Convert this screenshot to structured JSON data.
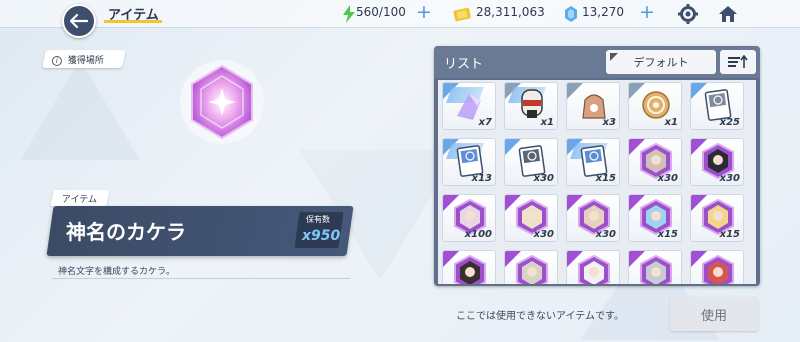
{
  "header": {
    "title": "アイテム",
    "back_icon": "arrow-left-icon",
    "stamina": "560/100",
    "coins": "28,311,063",
    "gems": "13,270",
    "settings_icon": "gear-icon",
    "home_icon": "home-icon"
  },
  "item_detail": {
    "source_button": "獲得場所",
    "category": "アイテム",
    "name": "神名のカケラ",
    "owned_label": "保有数",
    "owned_count": "x950",
    "description": "神名文字を構成するカケラ。"
  },
  "list": {
    "title": "リスト",
    "sort_label": "デフォルト",
    "order_icon": "sort-order-icon",
    "items": [
      {
        "qty": "x7",
        "kind": "crystal",
        "color": "#b9a0f5"
      },
      {
        "qty": "x1",
        "kind": "mask",
        "color": "#c0392b"
      },
      {
        "qty": "x3",
        "kind": "bag",
        "color": "#d8a080"
      },
      {
        "qty": "x1",
        "kind": "coin",
        "color": "#e0b070"
      },
      {
        "qty": "x25",
        "kind": "card",
        "color": "#7f8a9c"
      },
      {
        "qty": "x13",
        "kind": "card-blue",
        "color": "#5b8ed6"
      },
      {
        "qty": "x30",
        "kind": "card-dark",
        "color": "#5a6578"
      },
      {
        "qty": "x15",
        "kind": "card-blue",
        "color": "#5b8ed6"
      },
      {
        "qty": "x30",
        "kind": "portrait",
        "color": "#d1c0b8"
      },
      {
        "qty": "x30",
        "kind": "portrait",
        "color": "#2d2a38"
      },
      {
        "qty": "x100",
        "kind": "portrait",
        "color": "#e8d6e8"
      },
      {
        "qty": "x30",
        "kind": "portrait",
        "color": "#efe0c8"
      },
      {
        "qty": "x30",
        "kind": "portrait",
        "color": "#e6d0bf"
      },
      {
        "qty": "x15",
        "kind": "portrait",
        "color": "#9fd3f0"
      },
      {
        "qty": "x15",
        "kind": "portrait",
        "color": "#f3d68a"
      },
      {
        "qty": "",
        "kind": "portrait",
        "color": "#3a2e34"
      },
      {
        "qty": "",
        "kind": "portrait",
        "color": "#d8d2c4"
      },
      {
        "qty": "",
        "kind": "portrait",
        "color": "#f0f0f6"
      },
      {
        "qty": "",
        "kind": "portrait",
        "color": "#c9c9d6"
      },
      {
        "qty": "",
        "kind": "portrait",
        "color": "#d9534f"
      }
    ]
  },
  "footer": {
    "message": "ここでは使用できないアイテムです。",
    "use_button": "使用"
  },
  "colors": {
    "accent": "#4f9be0",
    "panel": "#5f6f8a",
    "name_bg": "#3b4b66",
    "rarity_purple": "#a14fd4",
    "highlight_yellow": "#f4c430"
  }
}
